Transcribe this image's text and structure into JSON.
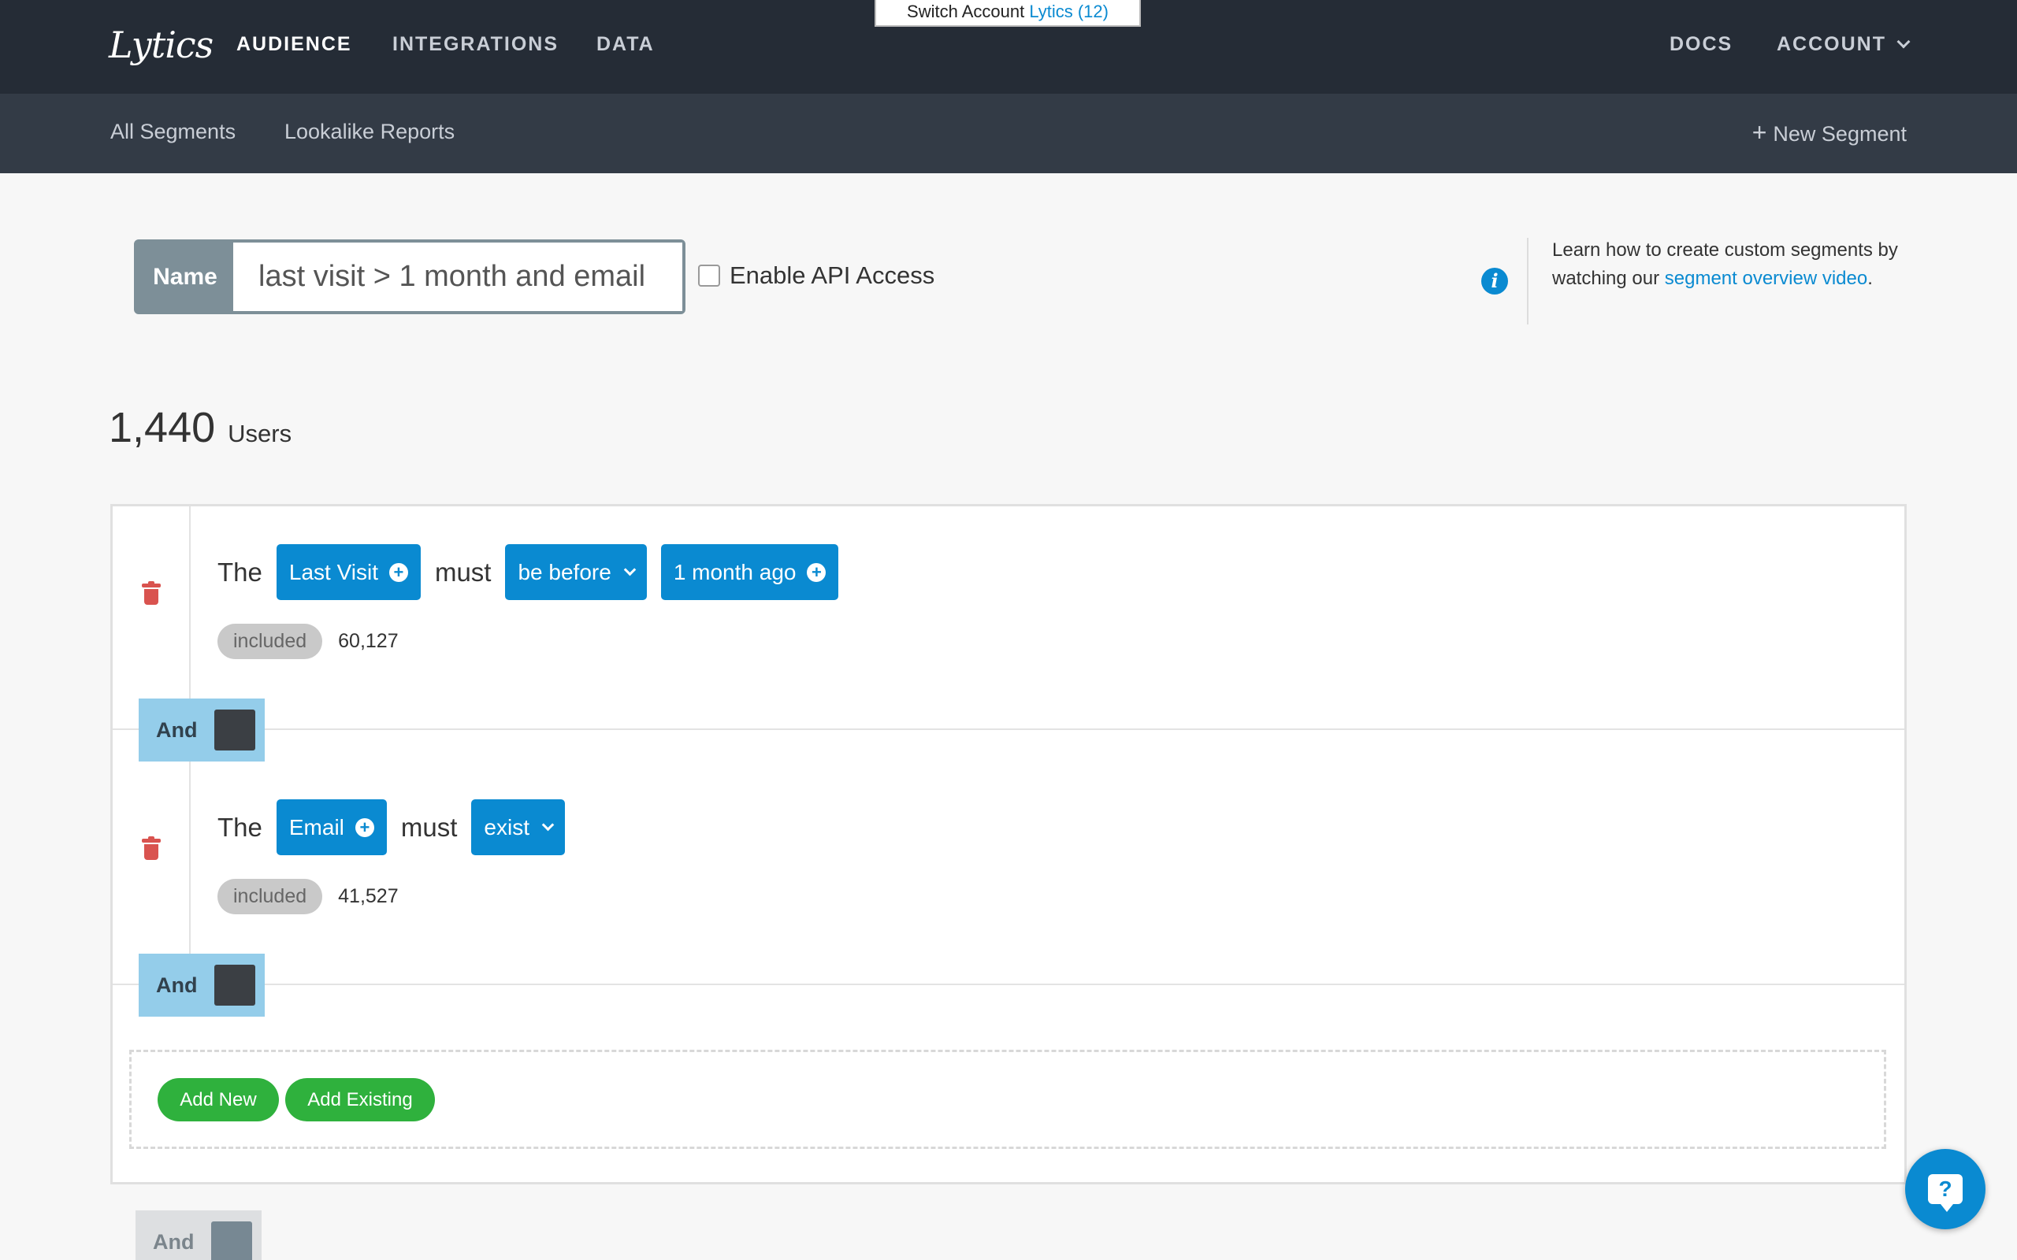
{
  "header": {
    "logo": "Lytics",
    "nav": [
      "AUDIENCE",
      "INTEGRATIONS",
      "DATA"
    ],
    "right_nav": [
      "DOCS",
      "ACCOUNT"
    ],
    "switch_account": {
      "label": "Switch Account",
      "account": "Lytics (12)"
    }
  },
  "subnav": {
    "items": [
      "All Segments",
      "Lookalike Reports"
    ],
    "new_segment": "New Segment"
  },
  "segment": {
    "name_label": "Name",
    "name_value": "last visit > 1 month and email",
    "api_access_label": "Enable API Access",
    "api_access_checked": false
  },
  "info": {
    "text": "Learn how to create custom segments by watching our ",
    "link": "segment overview video",
    "end": "."
  },
  "users": {
    "count": "1,440",
    "label": "Users"
  },
  "rules": [
    {
      "the": "The",
      "field": "Last Visit",
      "must": "must",
      "operator": "be before",
      "value": "1 month ago",
      "included_label": "included",
      "included_count": "60,127",
      "connector": "And"
    },
    {
      "the": "The",
      "field": "Email",
      "must": "must",
      "operator": "exist",
      "included_label": "included",
      "included_count": "41,527",
      "connector": "And"
    }
  ],
  "actions": {
    "add_new": "Add New",
    "add_existing": "Add Existing"
  },
  "bottom_connector": "And",
  "colors": {
    "topbar": "#252c36",
    "subbar": "#333b46",
    "accent": "#0a8ad1",
    "green": "#2fb13d",
    "and_block": "#94cdea",
    "delete": "#d9534f"
  },
  "icons": [
    "chevron-down-icon",
    "plus-icon",
    "info-icon",
    "trash-icon",
    "plus-circle-icon",
    "help-chat-icon"
  ]
}
